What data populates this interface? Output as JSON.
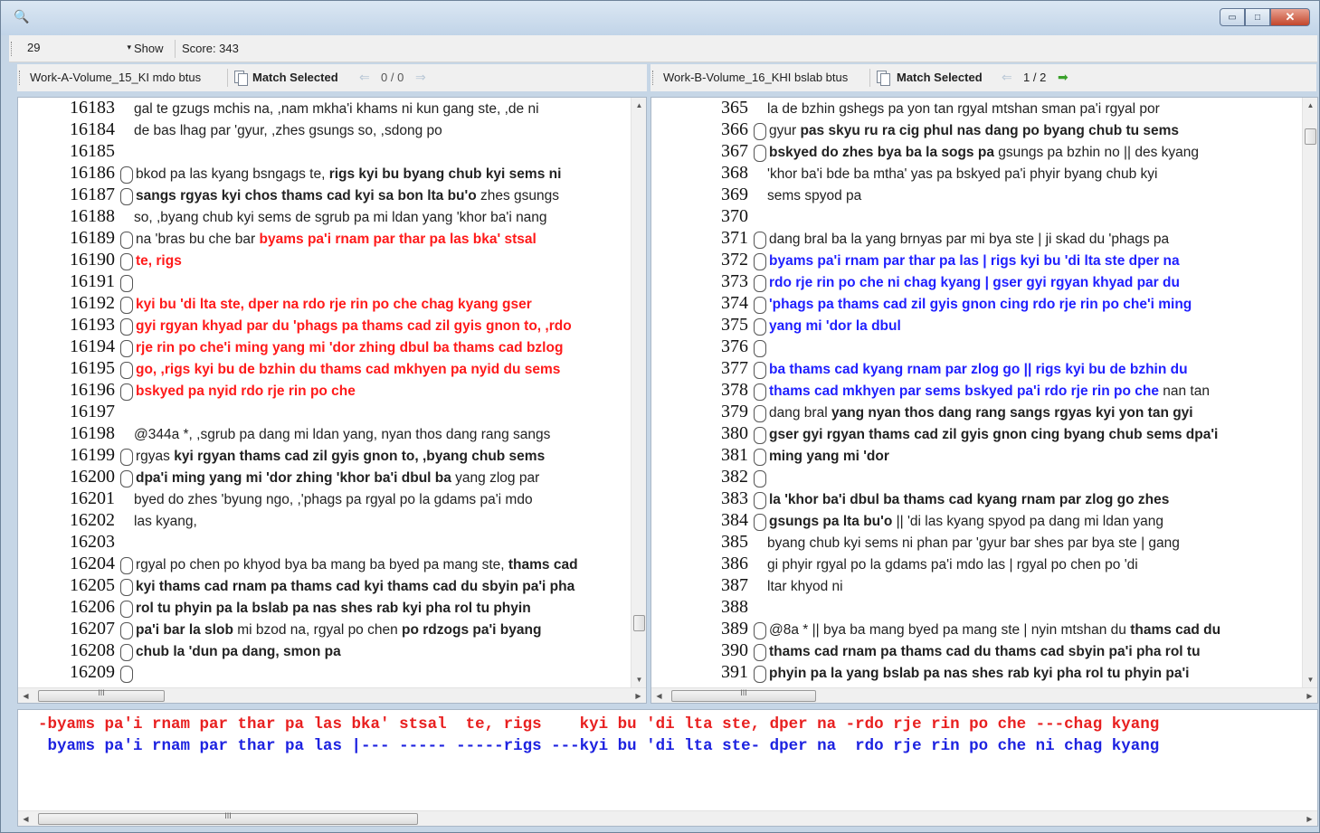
{
  "window": {
    "app_icon": "search-icon",
    "minimize_glyph": "▭",
    "maximize_glyph": "□",
    "close_glyph": "✕"
  },
  "toolbar": {
    "combo_value": "29",
    "combo_arrow": "▾",
    "show_label": "Show",
    "score_label": "Score: 343"
  },
  "left_header": {
    "work_label": "Work-A-Volume_15_KI mdo btus",
    "match_label": "Match Selected",
    "prev_arrow": "⇐",
    "counter": "0 / 0",
    "next_arrow": "⇒"
  },
  "right_header": {
    "work_label": "Work-B-Volume_16_KHI bslab btus",
    "match_label": "Match Selected",
    "prev_arrow": "⇐",
    "counter": "1 / 2",
    "next_arrow": "➡"
  },
  "scroll": {
    "up": "▲",
    "down": "▼",
    "left": "◀",
    "right": "▶",
    "grip": "III"
  },
  "left_lines": [
    {
      "num": "16183",
      "mark": false,
      "segs": [
        {
          "t": "gal te gzugs mchis na, ,nam mkha'i khams ni kun gang ste, ,de ni",
          "s": "n"
        }
      ]
    },
    {
      "num": "16184",
      "mark": false,
      "segs": [
        {
          "t": "de bas lhag par 'gyur, ,zhes gsungs so, ,sdong po",
          "s": "n"
        }
      ]
    },
    {
      "num": "16185",
      "mark": false,
      "segs": []
    },
    {
      "num": "16186",
      "mark": true,
      "segs": [
        {
          "t": "bkod pa las kyang bsngags te, ",
          "s": "n"
        },
        {
          "t": "rigs kyi bu byang chub kyi sems ni",
          "s": "b"
        }
      ]
    },
    {
      "num": "16187",
      "mark": true,
      "segs": [
        {
          "t": "sangs rgyas kyi chos thams cad kyi sa bon lta bu'o",
          "s": "b"
        },
        {
          "t": " zhes gsungs",
          "s": "n"
        }
      ]
    },
    {
      "num": "16188",
      "mark": false,
      "segs": [
        {
          "t": "so, ,byang chub kyi sems de sgrub pa mi ldan yang 'khor ba'i nang",
          "s": "n"
        }
      ]
    },
    {
      "num": "16189",
      "mark": true,
      "segs": [
        {
          "t": "na 'bras bu che bar ",
          "s": "n"
        },
        {
          "t": "byams pa'i rnam par thar pa las bka' stsal",
          "s": "r"
        }
      ]
    },
    {
      "num": "16190",
      "mark": true,
      "segs": [
        {
          "t": "te, rigs",
          "s": "r"
        }
      ]
    },
    {
      "num": "16191",
      "mark": true,
      "segs": []
    },
    {
      "num": "16192",
      "mark": true,
      "segs": [
        {
          "t": "kyi bu 'di lta ste, dper na rdo rje rin po che chag kyang gser",
          "s": "r"
        }
      ]
    },
    {
      "num": "16193",
      "mark": true,
      "segs": [
        {
          "t": "gyi rgyan khyad par du 'phags pa thams cad zil gyis gnon to, ,rdo",
          "s": "r"
        }
      ]
    },
    {
      "num": "16194",
      "mark": true,
      "segs": [
        {
          "t": "rje rin po che'i ming yang mi 'dor zhing dbul ba thams cad bzlog",
          "s": "r"
        }
      ]
    },
    {
      "num": "16195",
      "mark": true,
      "segs": [
        {
          "t": "go, ,rigs kyi bu de bzhin du thams cad mkhyen pa nyid du sems",
          "s": "r"
        }
      ]
    },
    {
      "num": "16196",
      "mark": true,
      "segs": [
        {
          "t": "bskyed pa nyid rdo rje rin po che",
          "s": "r"
        }
      ]
    },
    {
      "num": "16197",
      "mark": false,
      "segs": []
    },
    {
      "num": "16198",
      "mark": false,
      "segs": [
        {
          "t": "@344a *, ,sgrub pa dang mi ldan yang, nyan thos dang rang sangs",
          "s": "n"
        }
      ]
    },
    {
      "num": "16199",
      "mark": true,
      "segs": [
        {
          "t": "rgyas ",
          "s": "n"
        },
        {
          "t": "kyi rgyan thams cad zil gyis gnon to, ,byang chub sems",
          "s": "b"
        }
      ]
    },
    {
      "num": "16200",
      "mark": true,
      "segs": [
        {
          "t": "dpa'i ming yang mi 'dor zhing 'khor ba'i dbul ba",
          "s": "b"
        },
        {
          "t": " yang zlog par",
          "s": "n"
        }
      ]
    },
    {
      "num": "16201",
      "mark": false,
      "segs": [
        {
          "t": "byed do zhes 'byung ngo, ,'phags pa rgyal po la gdams pa'i mdo",
          "s": "n"
        }
      ]
    },
    {
      "num": "16202",
      "mark": false,
      "segs": [
        {
          "t": "las kyang,",
          "s": "n"
        }
      ]
    },
    {
      "num": "16203",
      "mark": false,
      "segs": []
    },
    {
      "num": "16204",
      "mark": true,
      "segs": [
        {
          "t": "rgyal po chen po khyod bya ba mang ba byed pa mang ste, ",
          "s": "n"
        },
        {
          "t": "thams cad",
          "s": "b"
        }
      ]
    },
    {
      "num": "16205",
      "mark": true,
      "segs": [
        {
          "t": "kyi thams cad rnam pa thams cad kyi thams cad du sbyin pa'i pha",
          "s": "b"
        }
      ]
    },
    {
      "num": "16206",
      "mark": true,
      "segs": [
        {
          "t": "rol tu phyin pa la bslab pa nas shes rab kyi pha rol tu phyin",
          "s": "b"
        }
      ]
    },
    {
      "num": "16207",
      "mark": true,
      "segs": [
        {
          "t": "pa'i bar la slob",
          "s": "b"
        },
        {
          "t": " mi bzod na, rgyal po chen ",
          "s": "n"
        },
        {
          "t": "po rdzogs pa'i byang",
          "s": "b"
        }
      ]
    },
    {
      "num": "16208",
      "mark": true,
      "segs": [
        {
          "t": "chub la 'dun pa dang, smon pa",
          "s": "b"
        }
      ]
    },
    {
      "num": "16209",
      "mark": true,
      "segs": []
    }
  ],
  "right_lines": [
    {
      "num": "365",
      "mark": false,
      "segs": [
        {
          "t": "la de bzhin gshegs pa yon tan rgyal mtshan sman pa'i rgyal por",
          "s": "n"
        }
      ]
    },
    {
      "num": "366",
      "mark": true,
      "segs": [
        {
          "t": "gyur ",
          "s": "n"
        },
        {
          "t": "pas skyu ru ra cig phul nas dang po byang chub tu sems",
          "s": "b"
        }
      ]
    },
    {
      "num": "367",
      "mark": true,
      "segs": [
        {
          "t": "bskyed do zhes bya ba la sogs pa",
          "s": "b"
        },
        {
          "t": " gsungs pa bzhin no || des kyang",
          "s": "n"
        }
      ]
    },
    {
      "num": "368",
      "mark": false,
      "segs": [
        {
          "t": "'khor ba'i bde ba mtha' yas pa bskyed pa'i phyir byang chub kyi",
          "s": "n"
        }
      ]
    },
    {
      "num": "369",
      "mark": false,
      "segs": [
        {
          "t": "sems spyod pa",
          "s": "n"
        }
      ]
    },
    {
      "num": "370",
      "mark": false,
      "segs": []
    },
    {
      "num": "371",
      "mark": true,
      "segs": [
        {
          "t": "dang bral ba la yang brnyas par mi bya ste |  ji skad du 'phags pa",
          "s": "n"
        }
      ]
    },
    {
      "num": "372",
      "mark": true,
      "segs": [
        {
          "t": "byams pa'i rnam par thar pa las |  rigs kyi bu 'di lta ste dper na",
          "s": "u"
        }
      ]
    },
    {
      "num": "373",
      "mark": true,
      "segs": [
        {
          "t": "rdo rje rin po che ni chag kyang |  gser gyi rgyan khyad par du",
          "s": "u"
        }
      ]
    },
    {
      "num": "374",
      "mark": true,
      "segs": [
        {
          "t": "'phags pa thams cad zil gyis gnon cing rdo rje rin po che'i ming",
          "s": "u"
        }
      ]
    },
    {
      "num": "375",
      "mark": true,
      "segs": [
        {
          "t": "yang mi 'dor la dbul",
          "s": "u"
        }
      ]
    },
    {
      "num": "376",
      "mark": true,
      "segs": []
    },
    {
      "num": "377",
      "mark": true,
      "segs": [
        {
          "t": "ba thams cad kyang rnam par zlog go || rigs kyi bu de bzhin du",
          "s": "u"
        }
      ]
    },
    {
      "num": "378",
      "mark": true,
      "segs": [
        {
          "t": "thams cad mkhyen par sems bskyed pa'i rdo rje rin po che",
          "s": "u"
        },
        {
          "t": " nan tan",
          "s": "n"
        }
      ]
    },
    {
      "num": "379",
      "mark": true,
      "segs": [
        {
          "t": "dang bral ",
          "s": "n"
        },
        {
          "t": "yang nyan thos dang rang sangs rgyas kyi yon tan gyi",
          "s": "b"
        }
      ]
    },
    {
      "num": "380",
      "mark": true,
      "segs": [
        {
          "t": "gser gyi rgyan thams cad zil gyis gnon cing byang chub sems dpa'i",
          "s": "b"
        }
      ]
    },
    {
      "num": "381",
      "mark": true,
      "segs": [
        {
          "t": "ming yang mi 'dor",
          "s": "b"
        }
      ]
    },
    {
      "num": "382",
      "mark": true,
      "segs": []
    },
    {
      "num": "383",
      "mark": true,
      "segs": [
        {
          "t": "la 'khor ba'i dbul ba thams cad kyang rnam par zlog go zhes",
          "s": "b"
        }
      ]
    },
    {
      "num": "384",
      "mark": true,
      "segs": [
        {
          "t": "gsungs pa lta bu'o",
          "s": "b"
        },
        {
          "t": " || 'di las kyang spyod pa dang mi ldan yang",
          "s": "n"
        }
      ]
    },
    {
      "num": "385",
      "mark": false,
      "segs": [
        {
          "t": "byang chub kyi sems ni phan par 'gyur bar shes par bya ste |  gang",
          "s": "n"
        }
      ]
    },
    {
      "num": "386",
      "mark": false,
      "segs": [
        {
          "t": "gi phyir rgyal po la gdams pa'i mdo las |  rgyal po chen po 'di",
          "s": "n"
        }
      ]
    },
    {
      "num": "387",
      "mark": false,
      "segs": [
        {
          "t": "ltar khyod ni",
          "s": "n"
        }
      ]
    },
    {
      "num": "388",
      "mark": false,
      "segs": []
    },
    {
      "num": "389",
      "mark": true,
      "segs": [
        {
          "t": "@8a * || bya ba mang byed pa mang ste |  nyin mtshan du ",
          "s": "n"
        },
        {
          "t": "thams cad du",
          "s": "b"
        }
      ]
    },
    {
      "num": "390",
      "mark": true,
      "segs": [
        {
          "t": "thams cad rnam pa thams cad du thams cad sbyin pa'i pha rol tu",
          "s": "b"
        }
      ]
    },
    {
      "num": "391",
      "mark": true,
      "segs": [
        {
          "t": "phyin pa la yang bslab pa nas shes rab kyi pha rol tu phyin pa'i",
          "s": "b"
        }
      ]
    }
  ],
  "alignment": {
    "line_a": "-byams pa'i rnam par thar pa las bka' stsal  te, rigs    kyi bu 'di lta ste, dper na -rdo rje rin po che ---chag kyang",
    "line_b": " byams pa'i rnam par thar pa las |--- ----- -----rigs ---kyi bu 'di lta ste- dper na  rdo rje rin po che ni chag kyang"
  }
}
